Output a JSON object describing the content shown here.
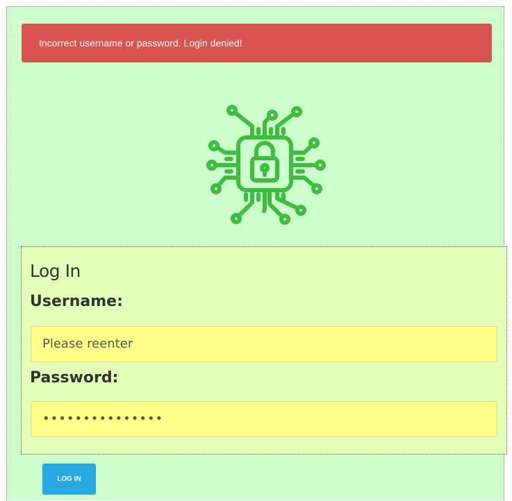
{
  "alert": {
    "message": "Incorrect username or password. Login denied!",
    "color": "#d9534f"
  },
  "logo": {
    "icon": "circuit-lock-icon",
    "color": "#3cbf3c"
  },
  "form": {
    "title": "Log In",
    "username_label": "Username:",
    "username_value": "Please reenter",
    "password_label": "Password:",
    "password_value": "•••••••••••••••",
    "submit_label": "LOG IN"
  },
  "colors": {
    "page_background": "#ccffcc",
    "panel_background": "#e4ffb8",
    "input_background": "#ffff88",
    "button": "#29a9e1"
  }
}
